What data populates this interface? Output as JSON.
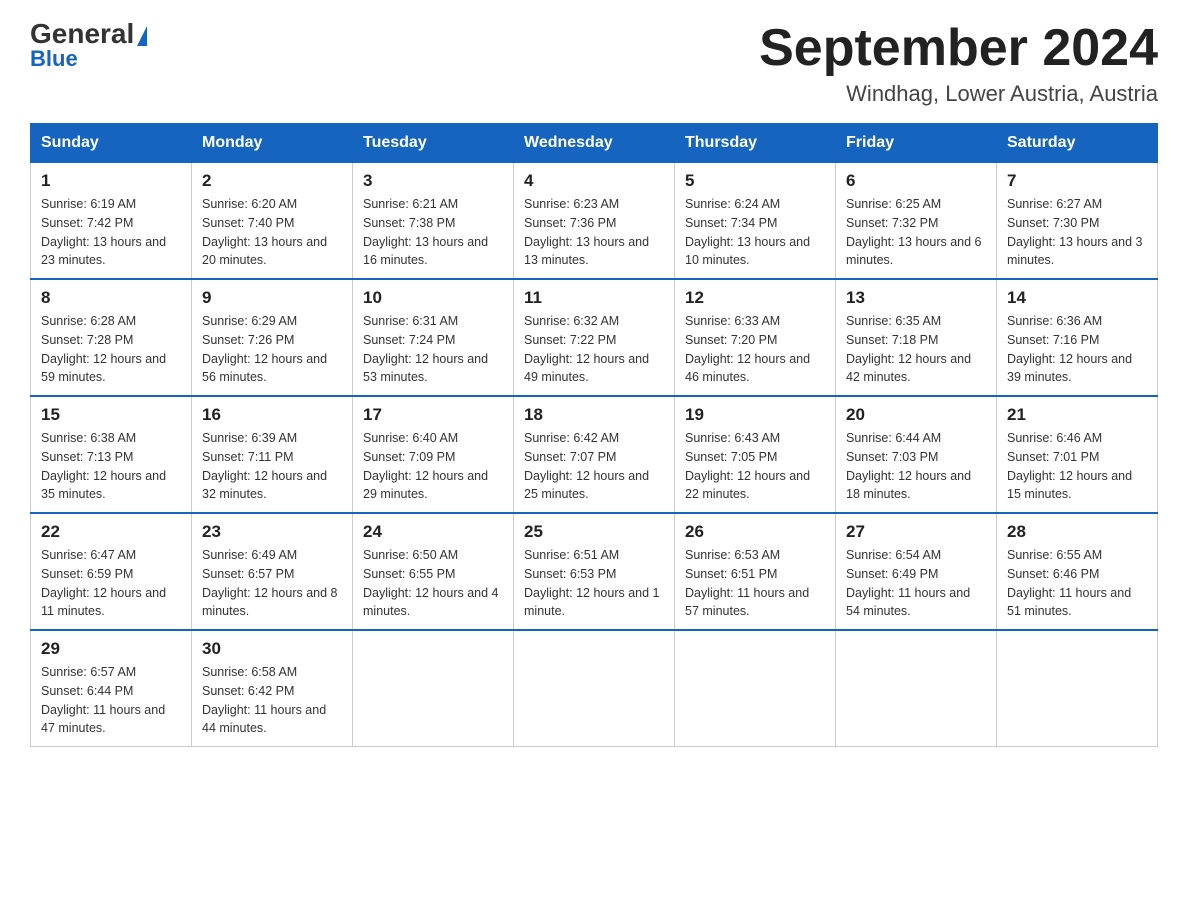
{
  "logo": {
    "general": "General",
    "blue": "Blue",
    "triangle": "▶"
  },
  "header": {
    "title": "September 2024",
    "subtitle": "Windhag, Lower Austria, Austria"
  },
  "weekdays": [
    "Sunday",
    "Monday",
    "Tuesday",
    "Wednesday",
    "Thursday",
    "Friday",
    "Saturday"
  ],
  "weeks": [
    [
      {
        "day": "1",
        "sunrise": "6:19 AM",
        "sunset": "7:42 PM",
        "daylight": "13 hours and 23 minutes."
      },
      {
        "day": "2",
        "sunrise": "6:20 AM",
        "sunset": "7:40 PM",
        "daylight": "13 hours and 20 minutes."
      },
      {
        "day": "3",
        "sunrise": "6:21 AM",
        "sunset": "7:38 PM",
        "daylight": "13 hours and 16 minutes."
      },
      {
        "day": "4",
        "sunrise": "6:23 AM",
        "sunset": "7:36 PM",
        "daylight": "13 hours and 13 minutes."
      },
      {
        "day": "5",
        "sunrise": "6:24 AM",
        "sunset": "7:34 PM",
        "daylight": "13 hours and 10 minutes."
      },
      {
        "day": "6",
        "sunrise": "6:25 AM",
        "sunset": "7:32 PM",
        "daylight": "13 hours and 6 minutes."
      },
      {
        "day": "7",
        "sunrise": "6:27 AM",
        "sunset": "7:30 PM",
        "daylight": "13 hours and 3 minutes."
      }
    ],
    [
      {
        "day": "8",
        "sunrise": "6:28 AM",
        "sunset": "7:28 PM",
        "daylight": "12 hours and 59 minutes."
      },
      {
        "day": "9",
        "sunrise": "6:29 AM",
        "sunset": "7:26 PM",
        "daylight": "12 hours and 56 minutes."
      },
      {
        "day": "10",
        "sunrise": "6:31 AM",
        "sunset": "7:24 PM",
        "daylight": "12 hours and 53 minutes."
      },
      {
        "day": "11",
        "sunrise": "6:32 AM",
        "sunset": "7:22 PM",
        "daylight": "12 hours and 49 minutes."
      },
      {
        "day": "12",
        "sunrise": "6:33 AM",
        "sunset": "7:20 PM",
        "daylight": "12 hours and 46 minutes."
      },
      {
        "day": "13",
        "sunrise": "6:35 AM",
        "sunset": "7:18 PM",
        "daylight": "12 hours and 42 minutes."
      },
      {
        "day": "14",
        "sunrise": "6:36 AM",
        "sunset": "7:16 PM",
        "daylight": "12 hours and 39 minutes."
      }
    ],
    [
      {
        "day": "15",
        "sunrise": "6:38 AM",
        "sunset": "7:13 PM",
        "daylight": "12 hours and 35 minutes."
      },
      {
        "day": "16",
        "sunrise": "6:39 AM",
        "sunset": "7:11 PM",
        "daylight": "12 hours and 32 minutes."
      },
      {
        "day": "17",
        "sunrise": "6:40 AM",
        "sunset": "7:09 PM",
        "daylight": "12 hours and 29 minutes."
      },
      {
        "day": "18",
        "sunrise": "6:42 AM",
        "sunset": "7:07 PM",
        "daylight": "12 hours and 25 minutes."
      },
      {
        "day": "19",
        "sunrise": "6:43 AM",
        "sunset": "7:05 PM",
        "daylight": "12 hours and 22 minutes."
      },
      {
        "day": "20",
        "sunrise": "6:44 AM",
        "sunset": "7:03 PM",
        "daylight": "12 hours and 18 minutes."
      },
      {
        "day": "21",
        "sunrise": "6:46 AM",
        "sunset": "7:01 PM",
        "daylight": "12 hours and 15 minutes."
      }
    ],
    [
      {
        "day": "22",
        "sunrise": "6:47 AM",
        "sunset": "6:59 PM",
        "daylight": "12 hours and 11 minutes."
      },
      {
        "day": "23",
        "sunrise": "6:49 AM",
        "sunset": "6:57 PM",
        "daylight": "12 hours and 8 minutes."
      },
      {
        "day": "24",
        "sunrise": "6:50 AM",
        "sunset": "6:55 PM",
        "daylight": "12 hours and 4 minutes."
      },
      {
        "day": "25",
        "sunrise": "6:51 AM",
        "sunset": "6:53 PM",
        "daylight": "12 hours and 1 minute."
      },
      {
        "day": "26",
        "sunrise": "6:53 AM",
        "sunset": "6:51 PM",
        "daylight": "11 hours and 57 minutes."
      },
      {
        "day": "27",
        "sunrise": "6:54 AM",
        "sunset": "6:49 PM",
        "daylight": "11 hours and 54 minutes."
      },
      {
        "day": "28",
        "sunrise": "6:55 AM",
        "sunset": "6:46 PM",
        "daylight": "11 hours and 51 minutes."
      }
    ],
    [
      {
        "day": "29",
        "sunrise": "6:57 AM",
        "sunset": "6:44 PM",
        "daylight": "11 hours and 47 minutes."
      },
      {
        "day": "30",
        "sunrise": "6:58 AM",
        "sunset": "6:42 PM",
        "daylight": "11 hours and 44 minutes."
      },
      null,
      null,
      null,
      null,
      null
    ]
  ]
}
